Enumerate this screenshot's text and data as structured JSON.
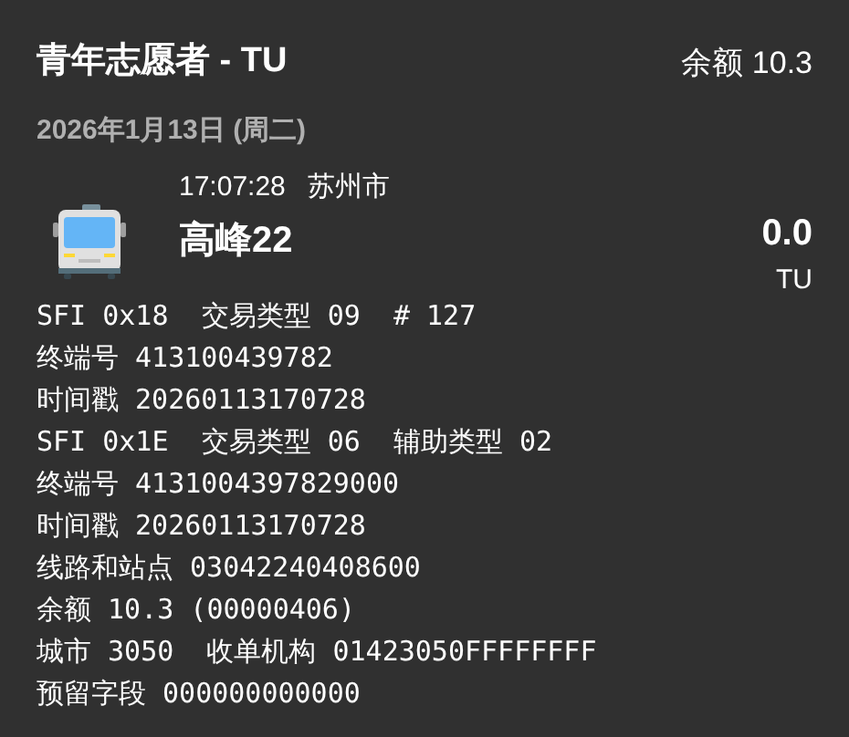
{
  "header": {
    "title": "青年志愿者 - TU",
    "balance": "余额 10.3"
  },
  "date": "2026年1月13日 (周二)",
  "trip": {
    "time": "17:07:28",
    "city": "苏州市",
    "line": "高峰22",
    "amount": "0.0",
    "currency": "TU"
  },
  "details": [
    "SFI 0x18  交易类型 09  # 127",
    "终端号 413100439782",
    "时间戳 20260113170728",
    "SFI 0x1E  交易类型 06  辅助类型 02",
    "终端号 4131004397829000",
    "时间戳 20260113170728",
    "线路和站点 03042240408600",
    "余额 10.3 (00000406)",
    "城市 3050  收单机构 01423050FFFFFFFF",
    "预留字段 000000000000"
  ]
}
